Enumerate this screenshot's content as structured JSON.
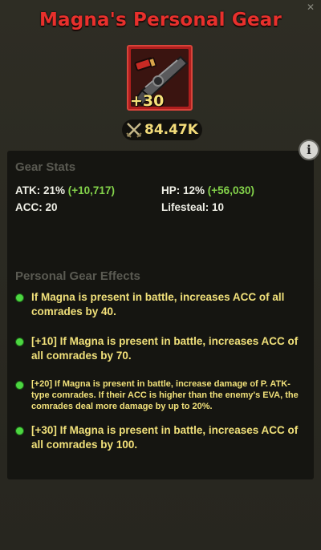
{
  "header": {
    "title": "Magna's Personal Gear"
  },
  "gear": {
    "level_badge": "+30",
    "power_value": "84.47K"
  },
  "stats": {
    "section_title": "Gear Stats",
    "atk_label": "ATK: 21%",
    "atk_bonus": "(+10,717)",
    "hp_label": "HP: 12%",
    "hp_bonus": "(+56,030)",
    "acc_label": "ACC: 20",
    "lifesteal_label": "Lifesteal: 10"
  },
  "effects": {
    "section_title": "Personal Gear Effects",
    "items": [
      {
        "pre": "If Magna is present in battle, increases ACC of all comrades by ",
        "value": "40",
        "post": "."
      },
      {
        "pre": "[+10] If Magna is present in battle, increases ACC of all comrades by ",
        "value": "70",
        "post": "."
      },
      {
        "pre": "[+20] If Magna is present in battle, increase damage of P. ATK-type comrades. If their ACC is higher than the enemy's EVA, the comrades deal more damage by up to 20%.",
        "value": "",
        "post": ""
      },
      {
        "pre": "[+30] If Magna is present in battle, increases ACC of all comrades by ",
        "value": "100",
        "post": "."
      }
    ]
  },
  "colors": {
    "title": "#e8302c",
    "stat_bonus": "#83d24a",
    "effect_text": "#f0e07a",
    "bullet": "#4cd641"
  },
  "icons": {
    "info": "info-icon",
    "power": "crossed-swords-icon",
    "gear": "shotgun-icon",
    "close": "close-icon"
  }
}
